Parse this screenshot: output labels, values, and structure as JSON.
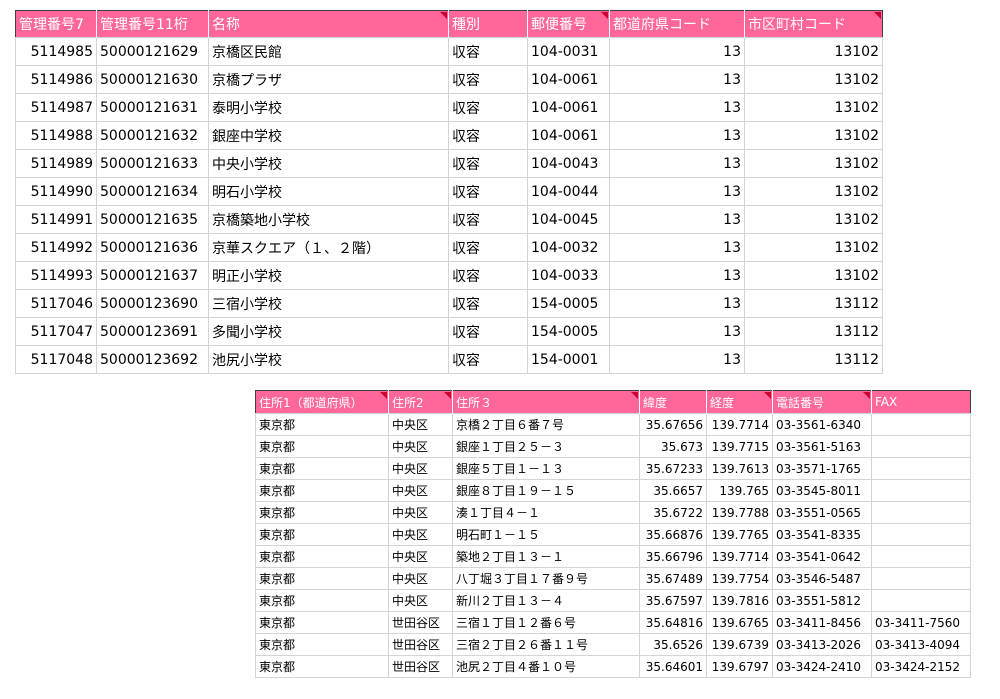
{
  "colors": {
    "header_bg": "#ff6699",
    "header_text": "#ffffff",
    "header_marker": "#cc0033",
    "grid": "#d4d4d4",
    "frame": "#404040"
  },
  "table1": {
    "headers": [
      "管理番号7",
      "管理番号11桁",
      "名称",
      "種別",
      "郵便番号",
      "都道府県コード",
      "市区町村コード"
    ],
    "rows": [
      [
        "5114985",
        "50000121629",
        "京橋区民館",
        "収容",
        "104-0031",
        "13",
        "13102"
      ],
      [
        "5114986",
        "50000121630",
        "京橋プラザ",
        "収容",
        "104-0061",
        "13",
        "13102"
      ],
      [
        "5114987",
        "50000121631",
        "泰明小学校",
        "収容",
        "104-0061",
        "13",
        "13102"
      ],
      [
        "5114988",
        "50000121632",
        "銀座中学校",
        "収容",
        "104-0061",
        "13",
        "13102"
      ],
      [
        "5114989",
        "50000121633",
        "中央小学校",
        "収容",
        "104-0043",
        "13",
        "13102"
      ],
      [
        "5114990",
        "50000121634",
        "明石小学校",
        "収容",
        "104-0044",
        "13",
        "13102"
      ],
      [
        "5114991",
        "50000121635",
        "京橋築地小学校",
        "収容",
        "104-0045",
        "13",
        "13102"
      ],
      [
        "5114992",
        "50000121636",
        "京華スクエア（１、２階）",
        "収容",
        "104-0032",
        "13",
        "13102"
      ],
      [
        "5114993",
        "50000121637",
        "明正小学校",
        "収容",
        "104-0033",
        "13",
        "13102"
      ],
      [
        "5117046",
        "50000123690",
        "三宿小学校",
        "収容",
        "154-0005",
        "13",
        "13112"
      ],
      [
        "5117047",
        "50000123691",
        "多聞小学校",
        "収容",
        "154-0005",
        "13",
        "13112"
      ],
      [
        "5117048",
        "50000123692",
        "池尻小学校",
        "収容",
        "154-0001",
        "13",
        "13112"
      ]
    ]
  },
  "table2": {
    "headers": [
      "住所1（都道府県）",
      "住所2",
      "住所３",
      "緯度",
      "経度",
      "電話番号",
      "FAX"
    ],
    "rows": [
      [
        "東京都",
        "中央区",
        "京橋２丁目６番７号",
        "35.67656",
        "139.7714",
        "03-3561-6340",
        ""
      ],
      [
        "東京都",
        "中央区",
        "銀座１丁目２５－３",
        "35.673",
        "139.7715",
        "03-3561-5163",
        ""
      ],
      [
        "東京都",
        "中央区",
        "銀座５丁目１－１３",
        "35.67233",
        "139.7613",
        "03-3571-1765",
        ""
      ],
      [
        "東京都",
        "中央区",
        "銀座８丁目１９－１５",
        "35.6657",
        "139.765",
        "03-3545-8011",
        ""
      ],
      [
        "東京都",
        "中央区",
        "湊１丁目４－１",
        "35.6722",
        "139.7788",
        "03-3551-0565",
        ""
      ],
      [
        "東京都",
        "中央区",
        "明石町１－１５",
        "35.66876",
        "139.7765",
        "03-3541-8335",
        ""
      ],
      [
        "東京都",
        "中央区",
        "築地２丁目１３－１",
        "35.66796",
        "139.7714",
        "03-3541-0642",
        ""
      ],
      [
        "東京都",
        "中央区",
        "八丁堀３丁目１７番９号",
        "35.67489",
        "139.7754",
        "03-3546-5487",
        ""
      ],
      [
        "東京都",
        "中央区",
        "新川２丁目１３－４",
        "35.67597",
        "139.7816",
        "03-3551-5812",
        ""
      ],
      [
        "東京都",
        "世田谷区",
        "三宿１丁目１２番６号",
        "35.64816",
        "139.6765",
        "03-3411-8456",
        "03-3411-7560"
      ],
      [
        "東京都",
        "世田谷区",
        "三宿２丁目２６番１１号",
        "35.6526",
        "139.6739",
        "03-3413-2026",
        "03-3413-4094"
      ],
      [
        "東京都",
        "世田谷区",
        "池尻２丁目４番１０号",
        "35.64601",
        "139.6797",
        "03-3424-2410",
        "03-3424-2152"
      ]
    ]
  }
}
